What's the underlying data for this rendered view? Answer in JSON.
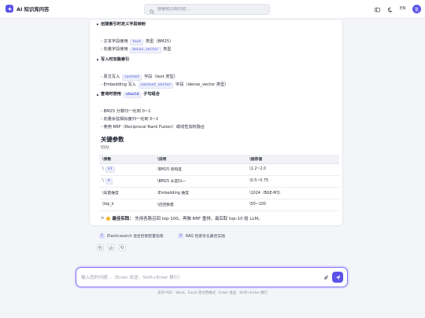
{
  "app": {
    "title": "AI 知识库问答",
    "avatar_initial": "张",
    "lang": "EN"
  },
  "search": {
    "placeholder": "搜索知识库内容..."
  },
  "answer": {
    "sections": [
      {
        "title": "创建索引时定义字段映射",
        "lines": [
          {
            "pre": "- 文本字段使用 ",
            "code": "text",
            "post": " 类型（BM25）"
          },
          {
            "pre": "- 向量字段使用 ",
            "code": "dense_vector",
            "post": " 类型"
          }
        ]
      },
      {
        "title": "写入时双路索引",
        "lines": [
          {
            "pre": "- 原文写入 ",
            "code": "content",
            "post": " 字段（text 类型）"
          },
          {
            "pre": "- Embedding 写入 ",
            "code": "content_vector",
            "post": " 字段（dense_vector 类型）"
          }
        ]
      },
      {
        "title_pre": "查询时使用 ",
        "title_code": "should",
        "title_post": " 子句组合",
        "lines": [
          {
            "pre": "- BM25 分数归一化到 0~1"
          },
          {
            "pre": "- 向量余弦相似度归一化到 0~1"
          },
          {
            "pre": "- 使用 RRF（Reciprocal Rank Fusion）或线性加权融合"
          }
        ]
      }
    ],
    "params_heading": "关键参数",
    "escape_text": "\\\\\\\\\\\\",
    "table": {
      "headers": [
        "\\参数",
        "\\说明",
        "\\推荐值"
      ],
      "rows": [
        {
          "param_pre": "\\ ",
          "param_code": "k1",
          "desc": "\\BM25 饱和度",
          "value": "\\1.2~2.0"
        },
        {
          "param_pre": "\\ ",
          "param_code": "b",
          "desc": "\\BM25 长度归一",
          "value": "\\0.5~0.75"
        },
        {
          "param": "\\向量维度",
          "desc": "\\Embedding 维度",
          "value": "\\1024（BGE-M3）"
        },
        {
          "param": "\\top_k",
          "desc": "\\召回数量",
          "value": "\\50~100"
        }
      ]
    },
    "tip": {
      "prefix": ">",
      "label": "最佳实践：",
      "text": "先用各路召回 top-100，再做 RRF 重排，最后取 top-10 给 LLM。"
    }
  },
  "sources": [
    {
      "index": "1",
      "label": "Elasticsearch 混合检索配置指南"
    },
    {
      "index": "2",
      "label": "RAG 检索优化最佳实践"
    }
  ],
  "composer": {
    "placeholder": "输入您的问题...（Enter 发送，Shift+Enter 换行）",
    "hint": "支持 PDF、Word、Excel 等文档格式 · Enter 发送 · Shift+Enter 换行"
  },
  "colors": {
    "accent": "#5b52e8",
    "code_text": "#4a52d4",
    "tip_bulb": "#f2b61d"
  }
}
